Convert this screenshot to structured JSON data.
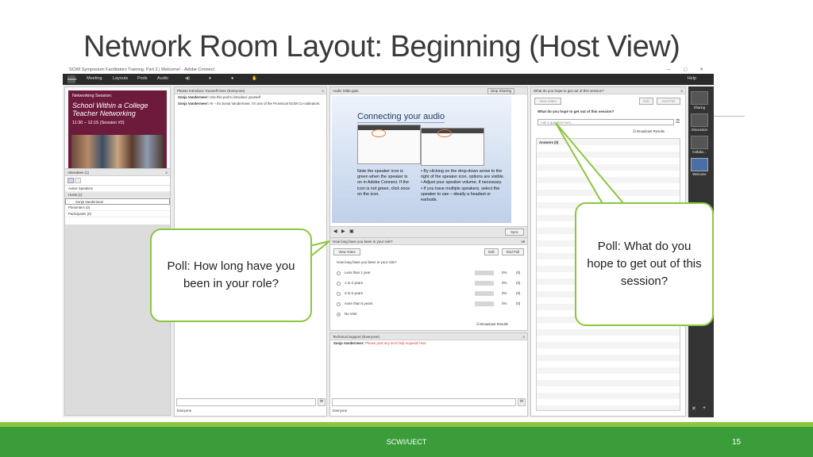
{
  "slide": {
    "title": "Network Room Layout: Beginning (Host View)",
    "footer_center": "SCWI/UECT",
    "page_number": "15"
  },
  "screen": {
    "window_title": "SCWI Symposium Facilitators Training, Part 2 | Welcome! - Adobe Connect",
    "window_controls": "— ▢ ✕",
    "logo": "Adobe",
    "menu": [
      "Meeting",
      "Layouts",
      "Pods",
      "Audio"
    ],
    "help": "Help"
  },
  "banner": {
    "line1": "Networking Session:",
    "line2": "School Within a College Teacher Networking",
    "line3": "11:30 – 12:15 (Session #2)"
  },
  "attendees": {
    "header": "Attendees (1)",
    "rows": [
      "Active Speakers",
      "Hosts (1)",
      "Sonja Vandermeer",
      "Presenters (0)",
      "Participants (0)"
    ]
  },
  "intro_chat": {
    "header": "Please Introduce Yourself Here (Everyone)",
    "lines": [
      {
        "who": "Sonja Vandermeer:",
        "text": "Use this pod to introduce yourself"
      },
      {
        "who": "Sonja Vandermeer:",
        "text": "Hi – it's Sonia Vandermeer. I'm one of the Provincial SCWI Co-ordinators."
      }
    ],
    "footer": "Everyone"
  },
  "audio_slide": {
    "header": "Audio Slide.pptx",
    "stop_sharing": "Stop Sharing",
    "heading": "Connecting your audio",
    "left_text": "Note the speaker icon is green when the speaker is on in Adobe Connect. If the icon is not green, click once on the icon.",
    "bullets": [
      "By clicking on the drop-down arrow to the right of the speaker icon, options are visible.",
      "Adjust your speaker volume, if necessary.",
      "If you have multiple speakers, select the speaker to use – ideally a headset or earbuds."
    ],
    "sync": "Sync"
  },
  "poll1": {
    "header": "How long have you been in your role?",
    "view_votes": "View Votes",
    "edit": "Edit",
    "end_poll": "End Poll",
    "question": "How long have you been in your role?",
    "options": [
      {
        "label": "Less than 1 year",
        "pct": "0%",
        "count": "(0)",
        "selected": false
      },
      {
        "label": "1 to 2 years",
        "pct": "0%",
        "count": "(0)",
        "selected": false
      },
      {
        "label": "3 to 5 years",
        "pct": "0%",
        "count": "(0)",
        "selected": false
      },
      {
        "label": "more than 5 years",
        "pct": "0%",
        "count": "(0)",
        "selected": false
      },
      {
        "label": "No Vote",
        "pct": "",
        "count": "",
        "selected": true
      }
    ],
    "broadcast": "Broadcast Results"
  },
  "tech": {
    "header": "Technical Support (Everyone)",
    "who": "Sonja Vandermeer:",
    "text": "Please post any tech help requests here",
    "footer": "Everyone"
  },
  "poll2": {
    "header": "What do you hope to get out of this session?",
    "view_votes": "View Votes",
    "edit": "Edit",
    "end_poll": "End Poll",
    "question": "What do you hope to get out of this session?",
    "input_value": "Ask a question here...",
    "broadcast": "Broadcast Results",
    "answers": "Answers (0)"
  },
  "layouts": [
    "Sharing",
    "Discussion",
    "Collabo...",
    "Welcome"
  ],
  "callouts": {
    "left": "Poll: How long have you been in your role?",
    "right": "Poll: What do you hope to get out of this session?"
  },
  "colors": {
    "accent_green": "#8cc63f",
    "footer_green": "#3a9d3a",
    "banner": "#6e1a3c"
  }
}
